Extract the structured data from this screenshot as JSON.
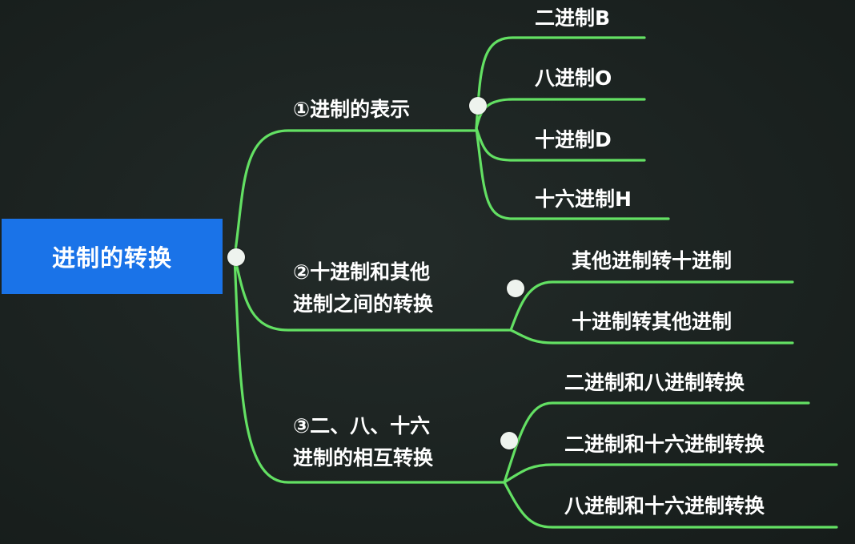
{
  "root": {
    "label": "进制的转换"
  },
  "branches": [
    {
      "label_lines": [
        "①进制的表示"
      ],
      "children": [
        "二进制B",
        "八进制O",
        "十进制D",
        "十六进制H"
      ]
    },
    {
      "label_lines": [
        "②十进制和其他",
        "进制之间的转换"
      ],
      "children": [
        "其他进制转十进制",
        "十进制转其他进制"
      ]
    },
    {
      "label_lines": [
        "③二、八、十六",
        "进制的相互转换"
      ],
      "children": [
        "二进制和八进制转换",
        "二进制和十六进制转换",
        "八进制和十六进制转换"
      ]
    }
  ],
  "colors": {
    "background": "#1c2321",
    "root_fill": "#1a73e8",
    "connector": "#63e063",
    "knot": "#eef3ee",
    "text": "#ffffff"
  }
}
